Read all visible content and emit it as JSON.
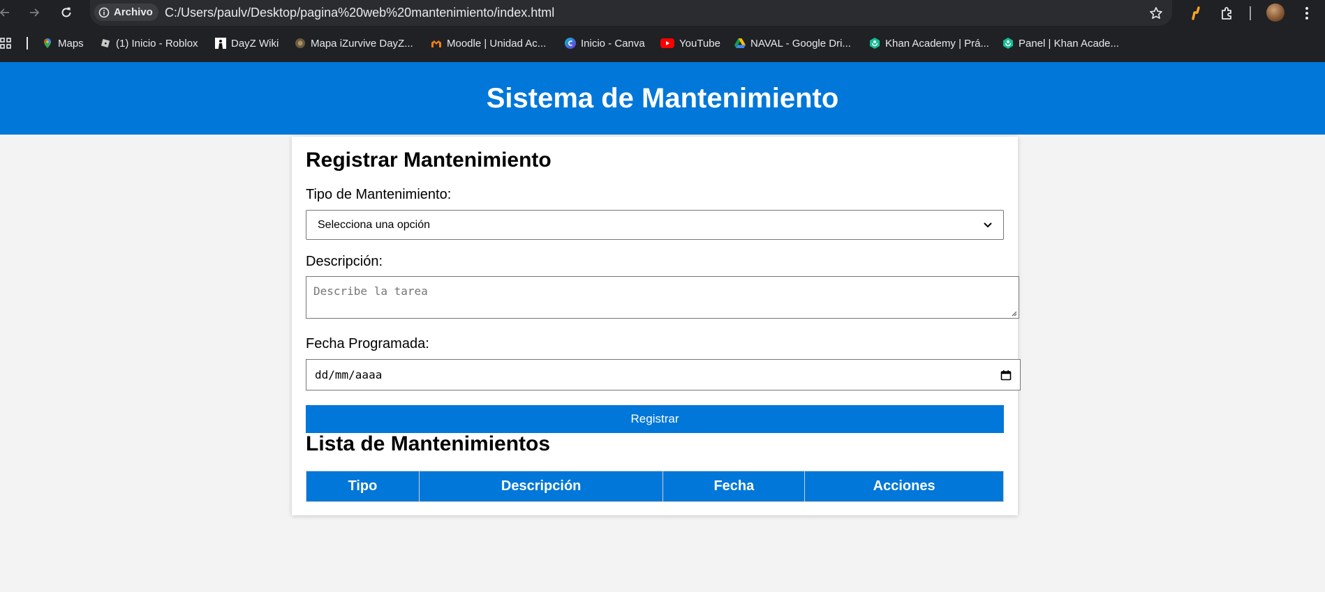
{
  "browser": {
    "site_chip_label": "Archivo",
    "url": "C:/Users/paulv/Desktop/pagina%20web%20mantenimiento/index.html",
    "bookmarks": [
      {
        "label": "Maps",
        "icon": "maps-pin-icon"
      },
      {
        "label": "(1) Inicio - Roblox",
        "icon": "roblox-icon"
      },
      {
        "label": "DayZ Wiki",
        "icon": "dayz-icon"
      },
      {
        "label": "Mapa iZurvive DayZ...",
        "icon": "izurvive-icon"
      },
      {
        "label": "Moodle | Unidad Ac...",
        "icon": "moodle-icon"
      },
      {
        "label": "Inicio - Canva",
        "icon": "canva-icon"
      },
      {
        "label": "YouTube",
        "icon": "youtube-icon"
      },
      {
        "label": "NAVAL - Google Dri...",
        "icon": "google-drive-icon"
      },
      {
        "label": "Khan Academy | Prá...",
        "icon": "khan-academy-icon"
      },
      {
        "label": "Panel | Khan Acade...",
        "icon": "khan-academy-icon"
      }
    ]
  },
  "page": {
    "header_title": "Sistema de Mantenimiento",
    "form": {
      "title": "Registrar Mantenimiento",
      "type_label": "Tipo de Mantenimiento:",
      "type_selected": "Selecciona una opción",
      "description_label": "Descripción:",
      "description_placeholder": "Describe la tarea",
      "date_label": "Fecha Programada:",
      "date_placeholder": "dd/mm/aaaa",
      "submit_label": "Registrar"
    },
    "list": {
      "title": "Lista de Mantenimientos",
      "columns": [
        "Tipo",
        "Descripción",
        "Fecha",
        "Acciones"
      ]
    }
  },
  "colors": {
    "brand_blue": "#0077d9",
    "page_background": "#f3f3f3",
    "browser_chrome": "#202124"
  }
}
